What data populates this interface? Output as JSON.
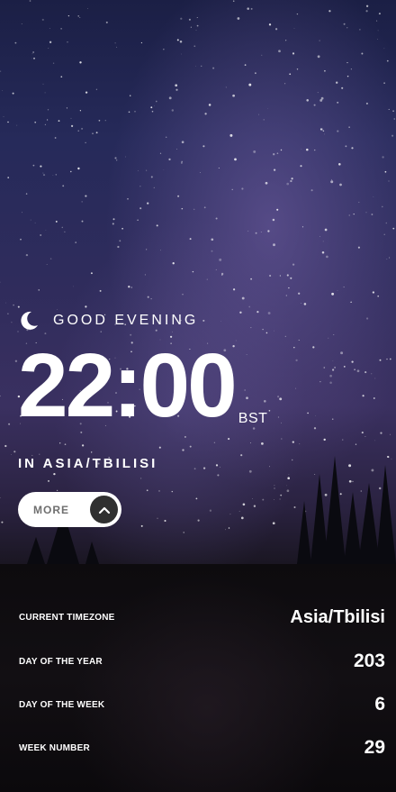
{
  "greeting": {
    "text": "GOOD EVENING",
    "icon": "moon-icon"
  },
  "clock": {
    "time": "22:00",
    "timezone_abbr": "BST"
  },
  "location": {
    "text": "IN ASIA/TBILISI"
  },
  "more_button": {
    "label": "MORE",
    "icon": "chevron-up-icon"
  },
  "details": {
    "rows": [
      {
        "label": "CURRENT TIMEZONE",
        "value": "Asia/Tbilisi"
      },
      {
        "label": "DAY OF THE YEAR",
        "value": "203"
      },
      {
        "label": "DAY OF THE WEEK",
        "value": "6"
      },
      {
        "label": "WEEK NUMBER",
        "value": "29"
      }
    ]
  },
  "colors": {
    "button_bg": "#ffffff",
    "button_text": "#6f6f6f",
    "chevron_bg": "#303030",
    "panel_bg": "#0d0b0e"
  }
}
